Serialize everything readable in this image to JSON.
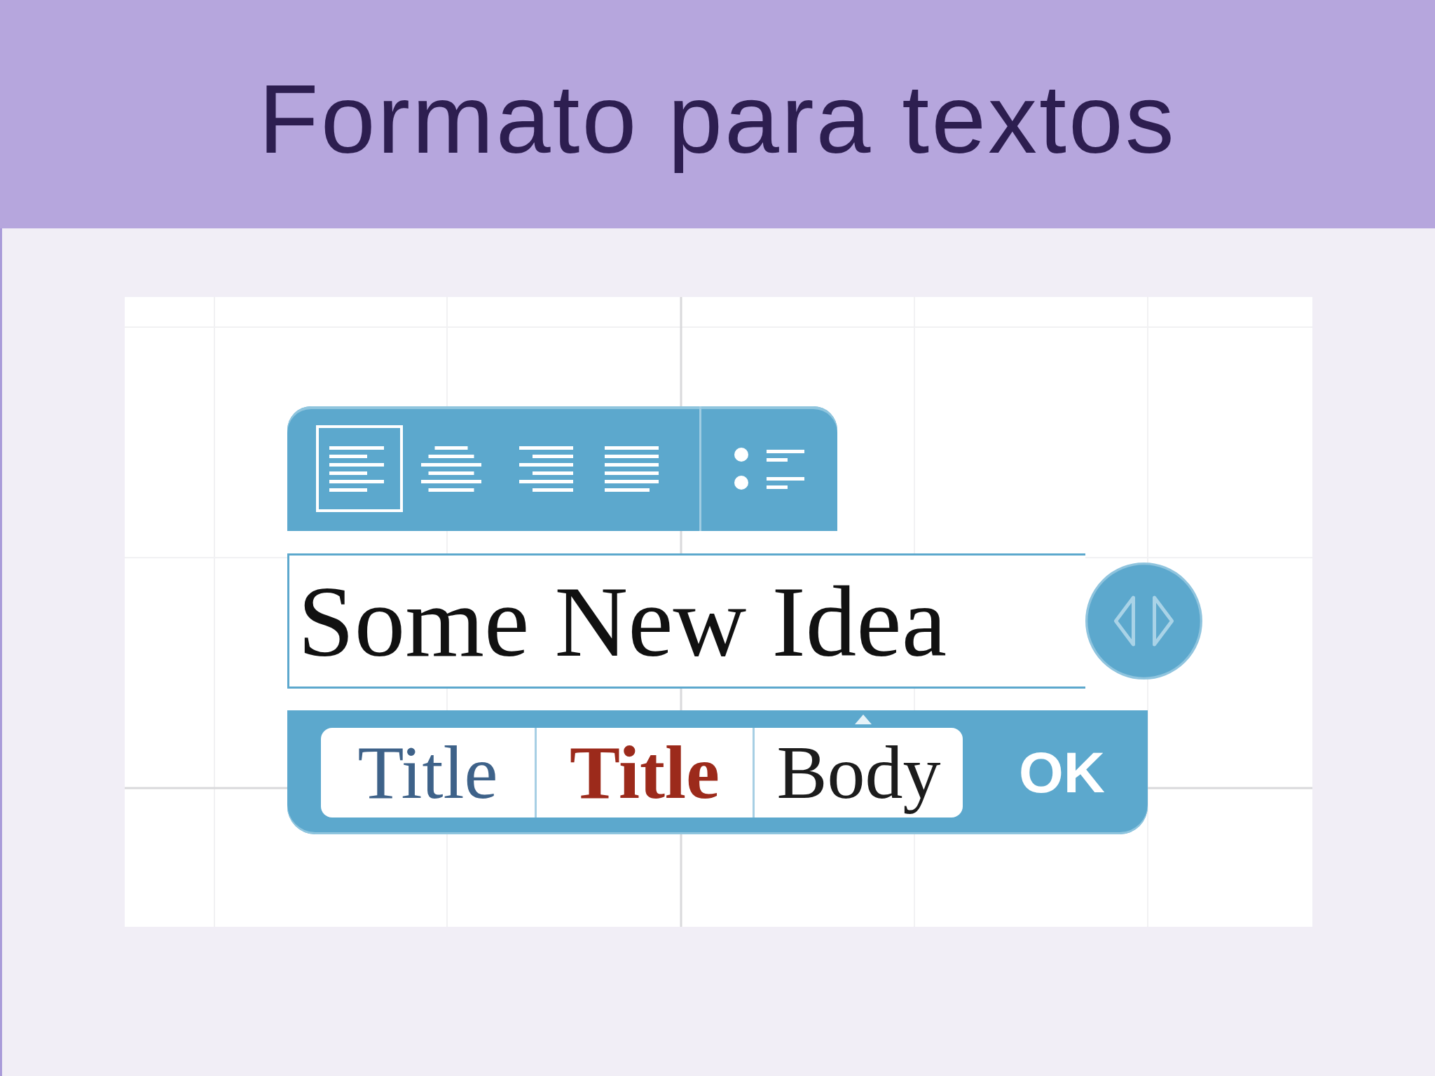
{
  "slide": {
    "title": "Formato para textos"
  },
  "editor": {
    "alignment": [
      {
        "kind": "left",
        "selected": true
      },
      {
        "kind": "center",
        "selected": false
      },
      {
        "kind": "right",
        "selected": false
      },
      {
        "kind": "justify",
        "selected": false
      }
    ],
    "text_field": {
      "value": "Some New Idea"
    },
    "styles": [
      {
        "label": "Title",
        "kind": "regular",
        "color": "#3e6289"
      },
      {
        "label": "Title",
        "kind": "bold",
        "color": "#9c2a1b"
      },
      {
        "label": "Body",
        "kind": "regular",
        "color": "#1c1c1c"
      }
    ],
    "confirm_button": "OK"
  }
}
